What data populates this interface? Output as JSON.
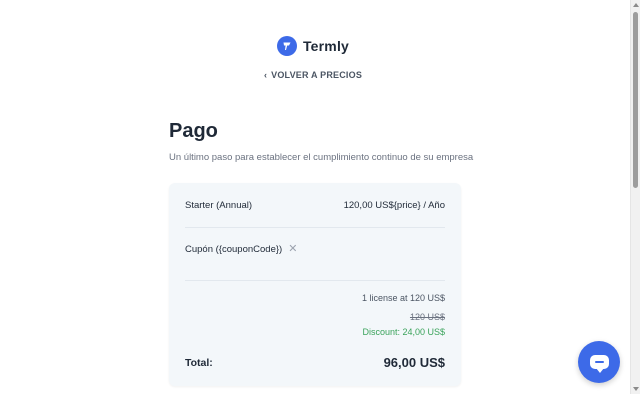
{
  "header": {
    "brand": "Termly",
    "back_link": "VOLVER A PRECIOS"
  },
  "main": {
    "title": "Pago",
    "subtitle": "Un último paso para establecer el cumplimiento continuo de su empresa"
  },
  "summary": {
    "plan_name": "Starter (Annual)",
    "plan_price": "120,00 US${price} / Año",
    "coupon_label": "Cupón ({couponCode})",
    "license_line": "1 license at 120 US$",
    "original_price": "120 US$",
    "discount": "Discount: 24,00 US$",
    "total_label": "Total:",
    "total_value": "96,00 US$"
  },
  "colors": {
    "accent": "#3d6ae8",
    "discount_green": "#3aa35b",
    "card_bg": "#f3f7fa"
  },
  "icons": {
    "logo": "termly-shield-icon",
    "back": "chevron-left-icon",
    "remove_coupon": "close-icon",
    "chat": "chat-icon"
  }
}
